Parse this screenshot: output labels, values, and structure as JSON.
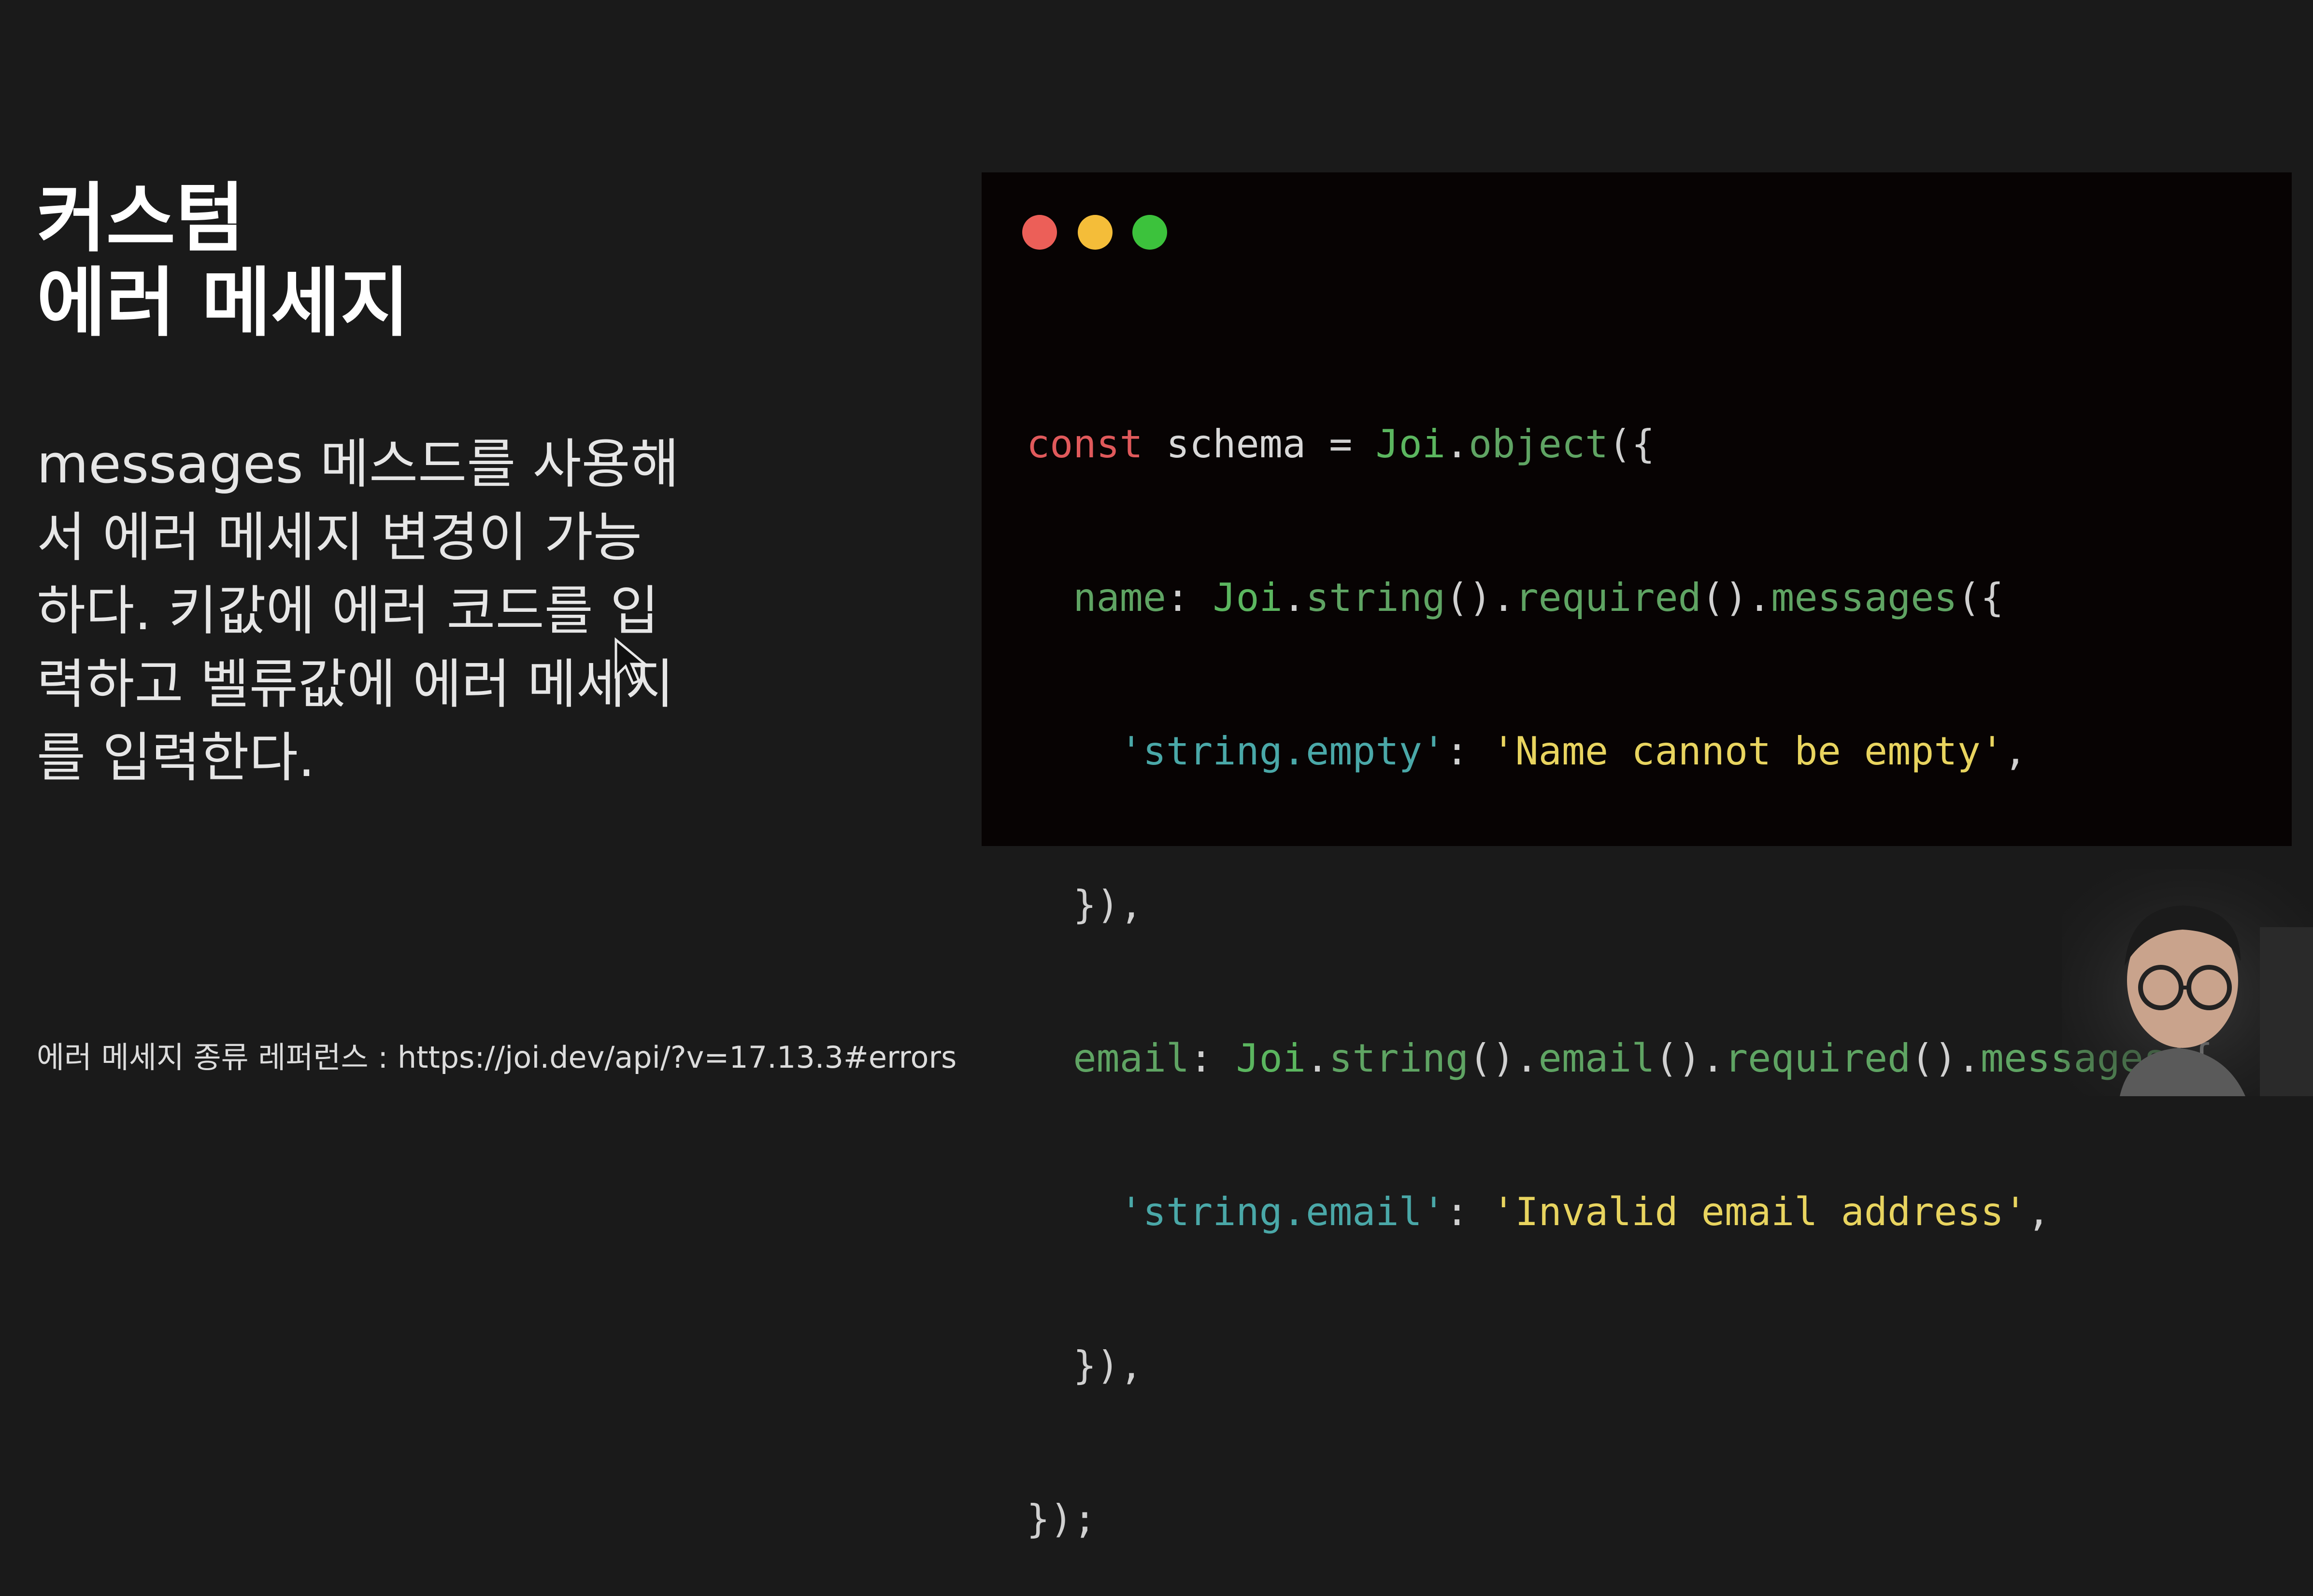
{
  "slide": {
    "title_lines": [
      "커스텀",
      "에러 메세지"
    ],
    "description": "messages 메스드를 사용해\n서 에러 메세지 변경이 가능\n하다. 키값에 에러 코드를 입\n력하고 벨류값에 에러 메세지\n를 입력한다.",
    "footer": "에러 메세지 종류 레퍼런스 : https://joi.dev/api/?v=17.13.3#errors"
  },
  "window_controls": {
    "close_color": "#ec5f58",
    "minimize_color": "#f4bd39",
    "maximize_color": "#3cc23c"
  },
  "code": {
    "tokens": [
      [
        "const",
        "schema",
        "=",
        "Joi",
        ".",
        "object",
        "({"
      ],
      [
        "name",
        ":",
        "Joi",
        ".",
        "string",
        "().",
        "required",
        "().",
        "messages",
        "({"
      ],
      [
        "'string.empty'",
        ":",
        "'Name cannot be empty'",
        ","
      ],
      [
        "}),"
      ],
      [
        "email",
        ":",
        "Joi",
        ".",
        "string",
        "().",
        "email",
        "().",
        "required",
        "().",
        "messages",
        "({"
      ],
      [
        "'string.email'",
        ":",
        "'Invalid email address'",
        ","
      ],
      [
        "}),"
      ],
      [
        "});"
      ]
    ]
  },
  "icons": {
    "cursor": "mouse-pointer-icon",
    "webcam": "presenter-webcam"
  }
}
